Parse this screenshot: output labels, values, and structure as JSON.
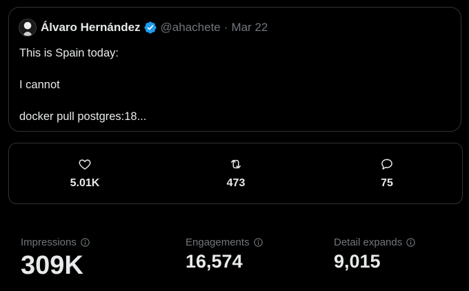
{
  "tweet": {
    "author_name": "Álvaro Hernández",
    "handle": "@ahachete",
    "separator": "·",
    "date": "Mar 22",
    "lines": [
      "This is Spain today:",
      "I cannot",
      "docker pull postgres:18..."
    ]
  },
  "engagement": {
    "likes": {
      "icon": "heart-icon",
      "count": "5.01K"
    },
    "reposts": {
      "icon": "repost-icon",
      "count": "473"
    },
    "replies": {
      "icon": "reply-icon",
      "count": "75"
    }
  },
  "metrics": [
    {
      "label": "Impressions",
      "value": "309K",
      "icon": "info-icon"
    },
    {
      "label": "Engagements",
      "value": "16,574",
      "icon": "info-icon"
    },
    {
      "label": "Detail expands",
      "value": "9,015",
      "icon": "info-icon"
    }
  ],
  "colors": {
    "background": "#000000",
    "text": "#e7e9ea",
    "muted": "#71767b",
    "border": "#2f3336",
    "verified": "#1d9bf0"
  }
}
